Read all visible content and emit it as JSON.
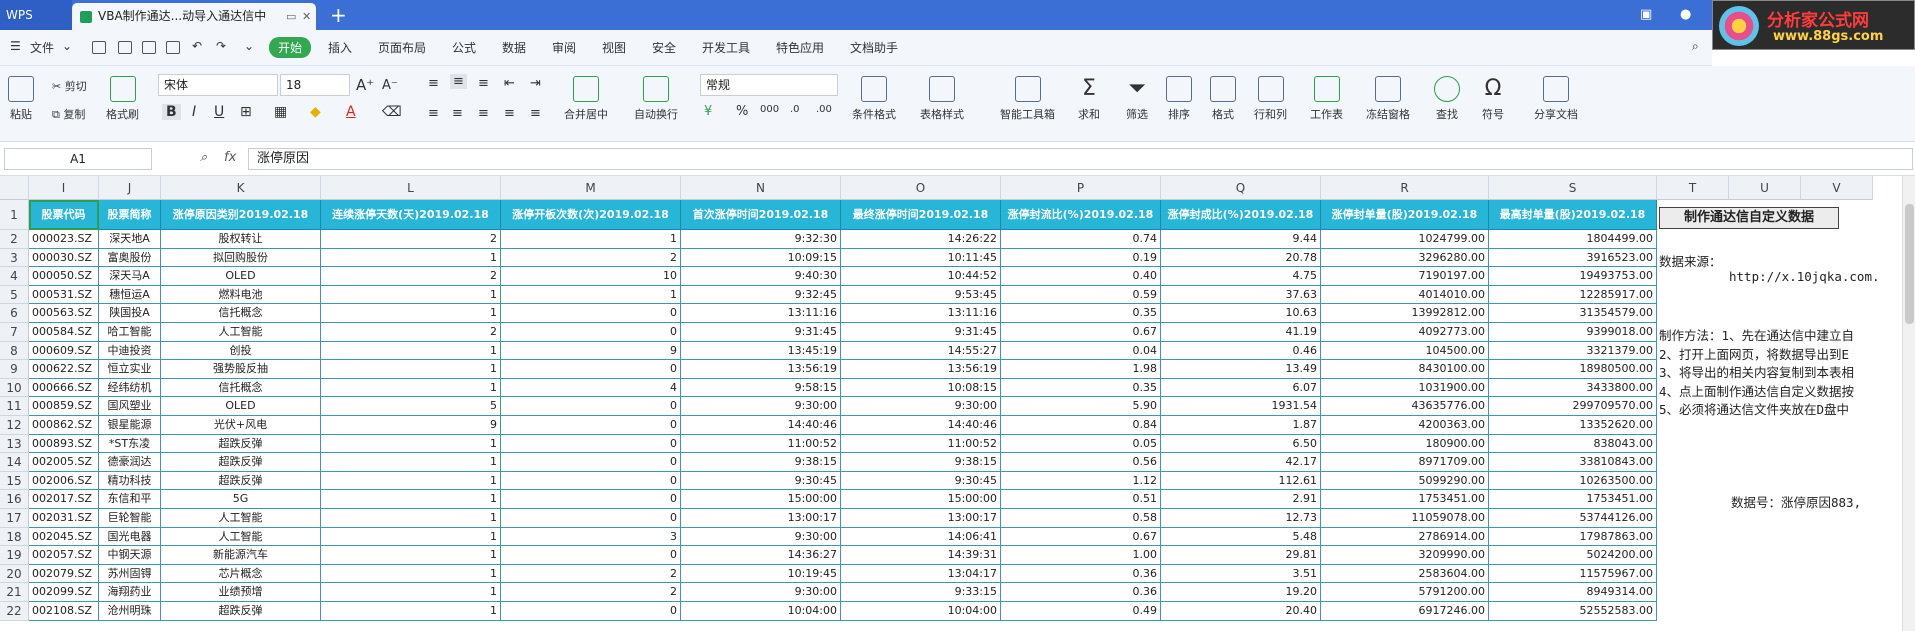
{
  "titlebar": {
    "app": "WPS",
    "doc_tab": "VBA制作通达...动导入通达信中",
    "new_tab": "+"
  },
  "logo": {
    "line1": "分析家公式网",
    "line2": "www.88gs.com"
  },
  "menu": {
    "file": "文件",
    "items": [
      "开始",
      "插入",
      "页面布局",
      "公式",
      "数据",
      "审阅",
      "视图",
      "安全",
      "开发工具",
      "特色应用",
      "文档助手"
    ],
    "active": "开始"
  },
  "ribbon": {
    "paste": "粘贴",
    "cut": "剪切",
    "copy": "复制",
    "format_painter": "格式刷",
    "font_name": "宋体",
    "font_size": "18",
    "merge_center": "合并居中",
    "auto_wrap": "自动换行",
    "number_format": "常规",
    "cond_format": "条件格式",
    "table_style": "表格样式",
    "smart_toolbox": "智能工具箱",
    "sum": "求和",
    "filter": "筛选",
    "sort": "排序",
    "format": "格式",
    "row_col": "行和列",
    "worksheet": "工作表",
    "freeze": "冻结窗格",
    "find": "查找",
    "symbol": "符号",
    "share": "分享文档"
  },
  "formula_bar": {
    "cell_ref": "A1",
    "fx": "fx",
    "content": "涨停原因"
  },
  "columns": [
    "I",
    "J",
    "K",
    "L",
    "M",
    "N",
    "O",
    "P",
    "Q",
    "R",
    "S",
    "T",
    "U",
    "V"
  ],
  "headers": [
    "股票代码",
    "股票简称",
    "涨停原因类别2019.02.18",
    "连续涨停天数(天)2019.02.18",
    "涨停开板次数(次)2019.02.18",
    "首次涨停时间2019.02.18",
    "最终涨停时间2019.02.18",
    "涨停封流比(%)2019.02.18",
    "涨停封成比(%)2019.02.18",
    "涨停封单量(股)2019.02.18",
    "最高封单量(股)2019.02.18"
  ],
  "rows": [
    [
      "000023.SZ",
      "深天地A",
      "股权转让",
      "2",
      "1",
      "9:32:30",
      "14:26:22",
      "0.74",
      "9.44",
      "1024799.00",
      "1804499.00"
    ],
    [
      "000030.SZ",
      "富奥股份",
      "拟回购股份",
      "1",
      "2",
      "10:09:15",
      "10:11:45",
      "0.19",
      "20.78",
      "3296280.00",
      "3916523.00"
    ],
    [
      "000050.SZ",
      "深天马A",
      "OLED",
      "2",
      "10",
      "9:40:30",
      "10:44:52",
      "0.40",
      "4.75",
      "7190197.00",
      "19493753.00"
    ],
    [
      "000531.SZ",
      "穗恒运A",
      "燃料电池",
      "1",
      "1",
      "9:32:45",
      "9:53:45",
      "0.59",
      "37.63",
      "4014010.00",
      "12285917.00"
    ],
    [
      "000563.SZ",
      "陕国投A",
      "信托概念",
      "1",
      "0",
      "13:11:16",
      "13:11:16",
      "0.35",
      "10.63",
      "13992812.00",
      "31354579.00"
    ],
    [
      "000584.SZ",
      "哈工智能",
      "人工智能",
      "2",
      "0",
      "9:31:45",
      "9:31:45",
      "0.67",
      "41.19",
      "4092773.00",
      "9399018.00"
    ],
    [
      "000609.SZ",
      "中迪投资",
      "创投",
      "1",
      "9",
      "13:45:19",
      "14:55:27",
      "0.04",
      "0.46",
      "104500.00",
      "3321379.00"
    ],
    [
      "000622.SZ",
      "恒立实业",
      "强势股反抽",
      "1",
      "0",
      "13:56:19",
      "13:56:19",
      "1.98",
      "13.49",
      "8430100.00",
      "18980500.00"
    ],
    [
      "000666.SZ",
      "经纬纺机",
      "信托概念",
      "1",
      "4",
      "9:58:15",
      "10:08:15",
      "0.35",
      "6.07",
      "1031900.00",
      "3433800.00"
    ],
    [
      "000859.SZ",
      "国风塑业",
      "OLED",
      "5",
      "0",
      "9:30:00",
      "9:30:00",
      "5.90",
      "1931.54",
      "43635776.00",
      "299709570.00"
    ],
    [
      "000862.SZ",
      "银星能源",
      "光伏+风电",
      "9",
      "0",
      "14:40:46",
      "14:40:46",
      "0.84",
      "1.87",
      "4200363.00",
      "13352620.00"
    ],
    [
      "000893.SZ",
      "*ST东凌",
      "超跌反弹",
      "1",
      "0",
      "11:00:52",
      "11:00:52",
      "0.05",
      "6.50",
      "180900.00",
      "838043.00"
    ],
    [
      "002005.SZ",
      "德豪润达",
      "超跌反弹",
      "1",
      "0",
      "9:38:15",
      "9:38:15",
      "0.56",
      "42.17",
      "8971709.00",
      "33810843.00"
    ],
    [
      "002006.SZ",
      "精功科技",
      "超跌反弹",
      "1",
      "0",
      "9:30:45",
      "9:30:45",
      "1.12",
      "112.61",
      "5099290.00",
      "10263500.00"
    ],
    [
      "002017.SZ",
      "东信和平",
      "5G",
      "1",
      "0",
      "15:00:00",
      "15:00:00",
      "0.51",
      "2.91",
      "1753451.00",
      "1753451.00"
    ],
    [
      "002031.SZ",
      "巨轮智能",
      "人工智能",
      "1",
      "0",
      "13:00:17",
      "13:00:17",
      "0.58",
      "12.73",
      "11059078.00",
      "53744126.00"
    ],
    [
      "002045.SZ",
      "国光电器",
      "人工智能",
      "1",
      "3",
      "9:30:00",
      "14:06:41",
      "0.67",
      "5.48",
      "2786914.00",
      "17987863.00"
    ],
    [
      "002057.SZ",
      "中钢天源",
      "新能源汽车",
      "1",
      "0",
      "14:36:27",
      "14:39:31",
      "1.00",
      "29.81",
      "3209990.00",
      "5024200.00"
    ],
    [
      "002079.SZ",
      "苏州固锝",
      "芯片概念",
      "1",
      "2",
      "10:19:45",
      "13:04:17",
      "0.36",
      "3.51",
      "2583604.00",
      "11575967.00"
    ],
    [
      "002099.SZ",
      "海翔药业",
      "业绩预增",
      "1",
      "2",
      "9:30:00",
      "9:33:15",
      "0.36",
      "19.20",
      "5791200.00",
      "8949314.00"
    ],
    [
      "002108.SZ",
      "沧州明珠",
      "超跌反弹",
      "1",
      "0",
      "10:04:00",
      "10:04:00",
      "0.49",
      "20.40",
      "6917246.00",
      "52552583.00"
    ]
  ],
  "side": {
    "macro_button": "制作通达信自定义数据",
    "source_label": "数据来源：",
    "url": "http://x.10jqka.com.",
    "steps": [
      "制作方法：1、先在通达信中建立自",
      "2、打开上面网页，将数据导出到E",
      "3、将导出的相关内容复制到本表相",
      "4、点上面制作通达信自定义数据按",
      "5、必须将通达信文件夹放在D盘中"
    ],
    "data_no": "数据号：涨停原因883,"
  }
}
